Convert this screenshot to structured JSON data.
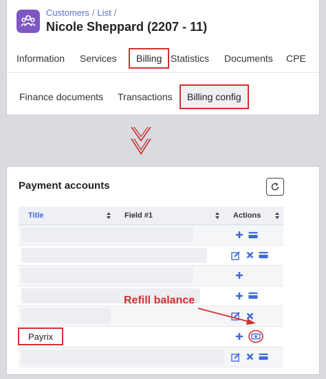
{
  "header": {
    "breadcrumb": [
      "Customers",
      "List"
    ],
    "breadcrumb_sep": "/",
    "title": "Nicole Sheppard (2207 - 11)"
  },
  "tabs": [
    "Information",
    "Services",
    "Billing",
    "Statistics",
    "Documents",
    "CPE"
  ],
  "active_tab": "Billing",
  "subtabs": [
    "Finance documents",
    "Transactions",
    "Billing config"
  ],
  "active_subtab": "Billing config",
  "payment_accounts": {
    "title": "Payment accounts",
    "columns": {
      "title": "Title",
      "field1": "Field #1",
      "actions": "Actions"
    },
    "rows": [
      {
        "title": "",
        "actions": [
          "add-icon",
          "card-icon"
        ]
      },
      {
        "title": "",
        "actions": [
          "edit-icon",
          "delete-icon",
          "card-icon"
        ]
      },
      {
        "title": "",
        "actions": [
          "add-icon"
        ]
      },
      {
        "title": "",
        "actions": [
          "add-icon",
          "card-icon"
        ]
      },
      {
        "title": "",
        "actions": [
          "edit-icon",
          "delete-icon"
        ]
      },
      {
        "title": "Payrix",
        "actions": [
          "add-icon",
          "refill-balance-icon"
        ]
      },
      {
        "title": "",
        "actions": [
          "edit-icon",
          "delete-icon",
          "card-icon"
        ]
      }
    ],
    "callout": "Refill balance"
  },
  "colors": {
    "accent": "#3f6ad8",
    "highlight": "#d32f2f",
    "app_icon": "#7e57c2"
  }
}
